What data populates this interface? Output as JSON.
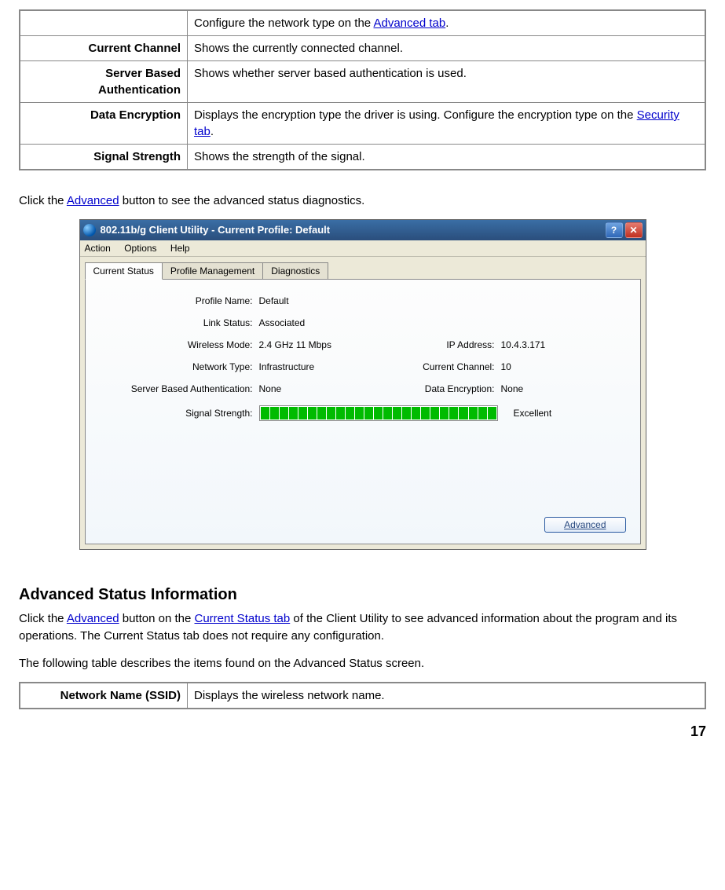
{
  "table1": {
    "rows": [
      {
        "label": "",
        "desc_pre": "Configure the network type on the ",
        "link": "Advanced tab",
        "desc_post": "."
      },
      {
        "label": "Current Channel",
        "desc": "Shows the currently connected channel."
      },
      {
        "label": "Server Based Authentication",
        "desc": "Shows whether server based authentication is used."
      },
      {
        "label": "Data Encryption",
        "desc_pre": "Displays the encryption type the driver is using.    Configure the encryption type on the ",
        "link": "Security tab",
        "desc_post": "."
      },
      {
        "label": "Signal Strength",
        "desc": "Shows the strength of the signal."
      }
    ]
  },
  "para1_pre": "Click the ",
  "para1_link": "Advanced",
  "para1_post": " button to see the advanced status diagnostics.",
  "window": {
    "title_prefix": "802.11b/",
    "title_g": "g",
    "title_rest": " Client Utility - Current Profile: Default",
    "menu": [
      "Action",
      "Options",
      "Help"
    ],
    "tabs": [
      "Current Status",
      "Profile Management",
      "Diagnostics"
    ],
    "fields": {
      "profile_name_lbl": "Profile Name:",
      "profile_name_val": "Default",
      "link_status_lbl": "Link Status:",
      "link_status_val": "Associated",
      "wireless_mode_lbl": "Wireless Mode:",
      "wireless_mode_val": "2.4 GHz 11 Mbps",
      "ip_lbl": "IP Address:",
      "ip_val": "10.4.3.171",
      "network_type_lbl": "Network Type:",
      "network_type_val": "Infrastructure",
      "current_channel_lbl": "Current Channel:",
      "current_channel_val": "10",
      "sba_lbl": "Server Based  Authentication:",
      "sba_val": "None",
      "de_lbl": "Data Encryption:",
      "de_val": "None",
      "signal_lbl": "Signal Strength:",
      "signal_text": "Excellent"
    },
    "advanced_btn": "Advanced"
  },
  "section_heading": "Advanced Status Information",
  "para2_parts": {
    "p1": "Click the ",
    "l1": "Advanced",
    "p2": " button on the ",
    "l2": "Current Status tab",
    "p3": " of the Client Utility to see advanced information about the program and its operations. The Current Status tab does not require any configuration."
  },
  "para3": "The following table describes the items found on the Advanced Status screen.",
  "table2": {
    "label": "Network Name (SSID)",
    "desc": "Displays the wireless network name."
  },
  "page_number": "17"
}
